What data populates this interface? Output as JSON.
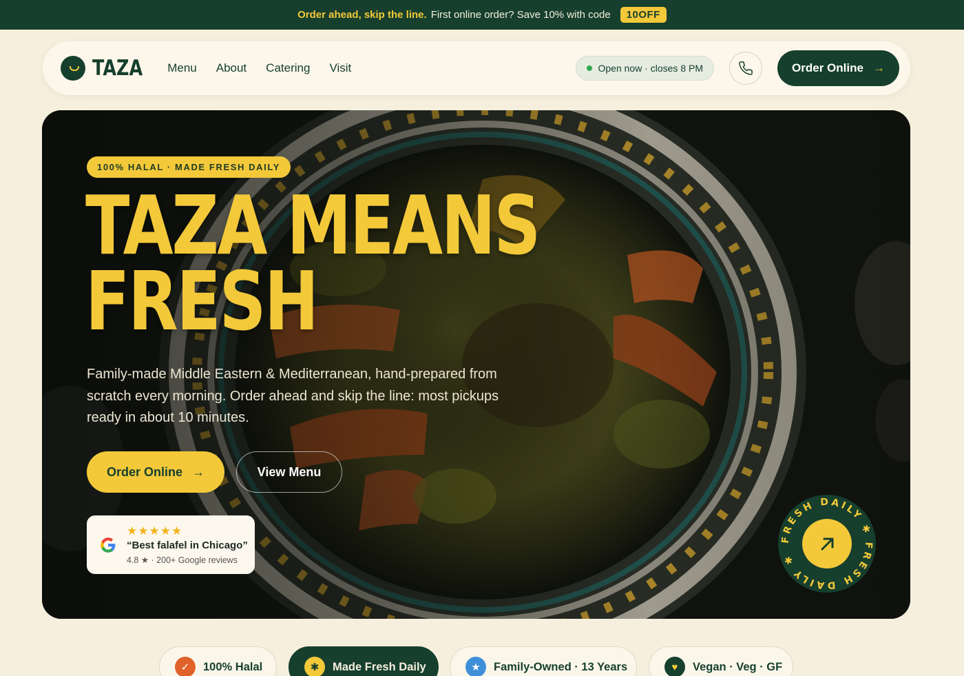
{
  "announcement": {
    "highlight": "Order ahead, skip the line.",
    "text": "First online order? Save 10% with code",
    "code": "10OFF"
  },
  "nav": {
    "brand": "TAZA",
    "links": [
      "Menu",
      "About",
      "Catering",
      "Visit"
    ],
    "status": "Open now · closes 8 PM",
    "order_label": "Order Online",
    "phone_icon": "phone-icon"
  },
  "hero": {
    "badge": "100% HALAL · MADE FRESH DAILY",
    "headline_line1": "TAZA MEANS",
    "headline_line2": "FRESH",
    "subtext": "Family-made Middle Eastern & Mediterranean, hand-prepared from scratch every morning. Order ahead and skip the line: most pickups ready in about 10 minutes.",
    "primary_cta": "Order Online",
    "secondary_cta": "View Menu",
    "review": {
      "stars": "★★★★★",
      "rating_stars": 5,
      "quote": "“Best falafel in Chicago”",
      "meta": "4.8 ★ · 200+ Google reviews"
    },
    "stamp_text": "FRESH DAILY ✱ FRESH DAILY ✱"
  },
  "features": [
    {
      "label": "100% Halal",
      "icon": "check-icon",
      "color": "#e0622a"
    },
    {
      "label": "Made Fresh Daily",
      "icon": "sparkle-icon",
      "color": "#f3c93a"
    },
    {
      "label": "Family-Owned · 13 Years",
      "icon": "star-icon",
      "color": "#3f8fd8"
    },
    {
      "label": "Vegan · Veg · GF",
      "icon": "heart-icon",
      "color": "#163f2d"
    }
  ],
  "colors": {
    "brand_green": "#163f2d",
    "accent_yellow": "#f3c93a",
    "cream": "#f6efde"
  }
}
